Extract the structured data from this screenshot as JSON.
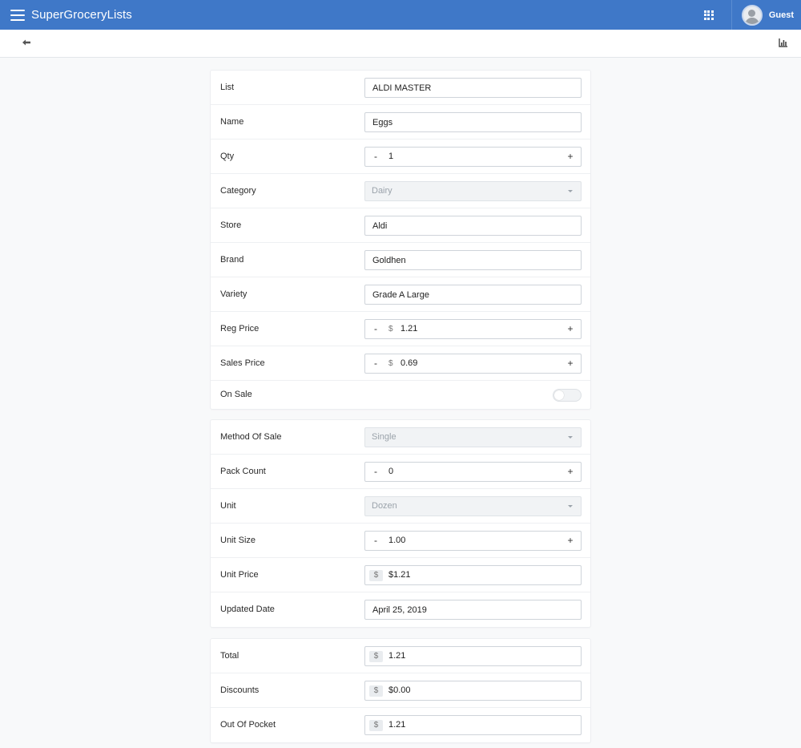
{
  "app": {
    "title": "SuperGroceryLists",
    "user": "Guest"
  },
  "icons": {
    "menu": "hamburger-icon",
    "apps": "grid-icon",
    "avatar": "user-avatar",
    "back": "back-arrow-icon",
    "chart": "bar-chart-icon"
  },
  "colors": {
    "header": "#3f78c8",
    "background": "#f8f9fa"
  },
  "item": {
    "list": {
      "label": "List",
      "value": "ALDI MASTER"
    },
    "name": {
      "label": "Name",
      "value": "Eggs"
    },
    "qty": {
      "label": "Qty",
      "value": "1",
      "minus": "-",
      "plus": "+"
    },
    "category": {
      "label": "Category",
      "value": "Dairy"
    },
    "store": {
      "label": "Store",
      "value": "Aldi"
    },
    "brand": {
      "label": "Brand",
      "value": "Goldhen"
    },
    "variety": {
      "label": "Variety",
      "value": "Grade A Large"
    },
    "reg_price": {
      "label": "Reg Price",
      "currency": "$",
      "value": "1.21",
      "minus": "-",
      "plus": "+"
    },
    "sales_price": {
      "label": "Sales Price",
      "currency": "$",
      "value": "0.69",
      "minus": "-",
      "plus": "+"
    },
    "on_sale": {
      "label": "On Sale",
      "checked": false
    }
  },
  "pricing": {
    "method_of_sale": {
      "label": "Method Of Sale",
      "value": "Single"
    },
    "pack_count": {
      "label": "Pack Count",
      "value": "0",
      "minus": "-",
      "plus": "+"
    },
    "unit": {
      "label": "Unit",
      "value": "Dozen"
    },
    "unit_size": {
      "label": "Unit Size",
      "value": "1.00",
      "minus": "-",
      "plus": "+"
    },
    "unit_price": {
      "label": "Unit Price",
      "prefix": "$",
      "value": "$1.21"
    },
    "updated_date": {
      "label": "Updated Date",
      "value": "April 25, 2019"
    }
  },
  "totals": {
    "total": {
      "label": "Total",
      "prefix": "$",
      "value": "1.21"
    },
    "discounts": {
      "label": "Discounts",
      "prefix": "$",
      "value": "$0.00"
    },
    "out_of_pocket": {
      "label": "Out Of Pocket",
      "prefix": "$",
      "value": "1.21"
    }
  }
}
